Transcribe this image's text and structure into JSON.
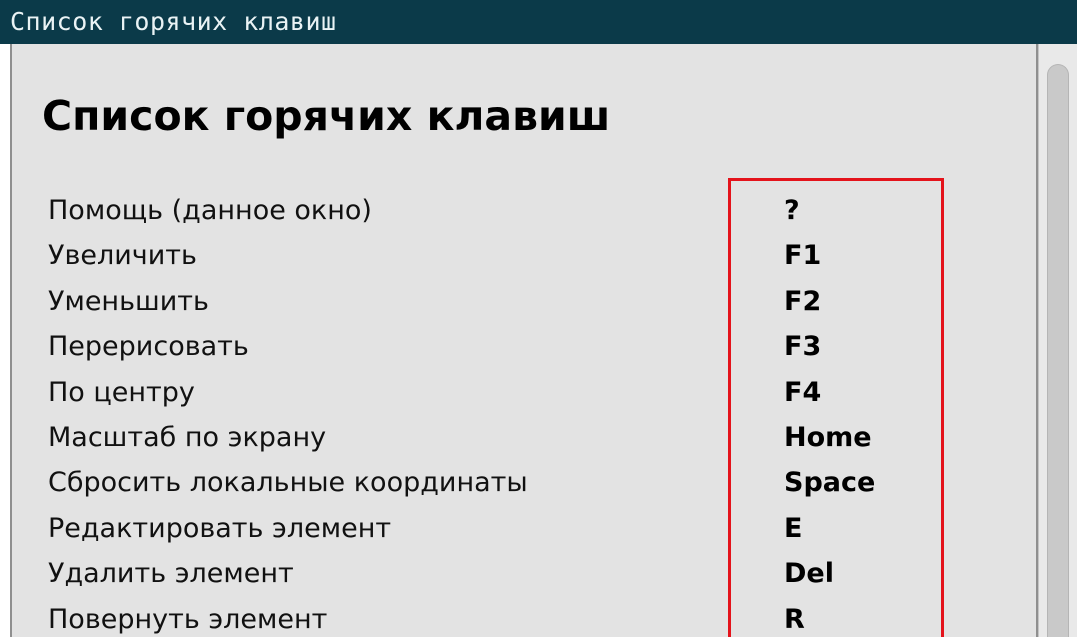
{
  "window": {
    "title": "Список горячих клавиш"
  },
  "content": {
    "heading": "Список горячих клавиш",
    "shortcuts": [
      {
        "action": "Помощь (данное окно)",
        "key": "?"
      },
      {
        "action": "Увеличить",
        "key": "F1"
      },
      {
        "action": "Уменьшить",
        "key": "F2"
      },
      {
        "action": "Перерисовать",
        "key": "F3"
      },
      {
        "action": "По центру",
        "key": "F4"
      },
      {
        "action": "Масштаб по экрану",
        "key": "Home"
      },
      {
        "action": "Сбросить локальные координаты",
        "key": "Space"
      },
      {
        "action": "Редактировать элемент",
        "key": "E"
      },
      {
        "action": "Удалить элемент",
        "key": "Del"
      },
      {
        "action": "Повернуть элемент",
        "key": "R"
      }
    ]
  },
  "colors": {
    "titlebar_bg": "#0b3a49",
    "content_bg": "#e3e3e3",
    "highlight_border": "#e4131b"
  }
}
